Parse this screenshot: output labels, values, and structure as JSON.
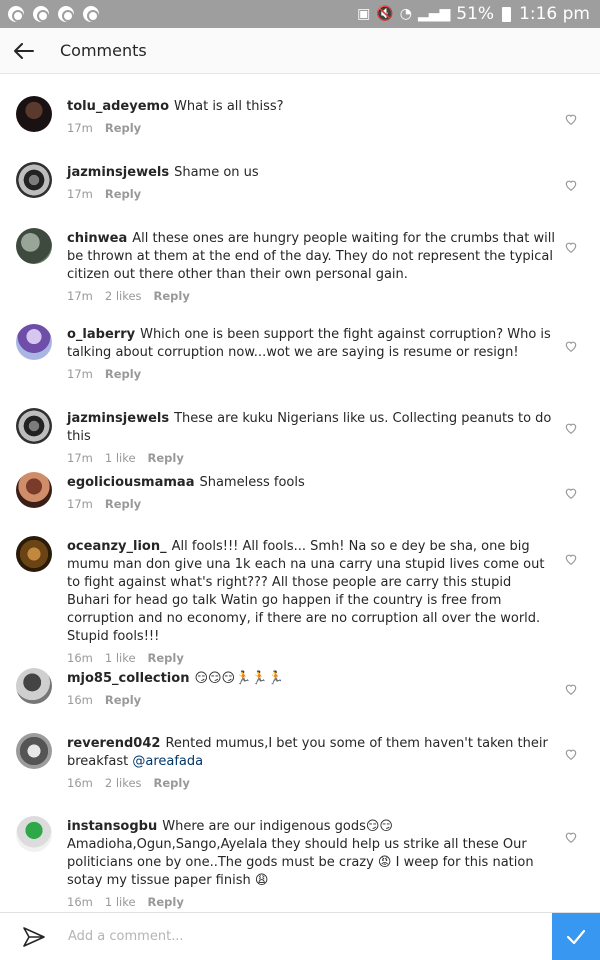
{
  "status_bar": {
    "battery_percent": "51%",
    "time": "1:16 pm",
    "signal_glyph": "↗"
  },
  "header": {
    "title": "Comments",
    "back_icon": "arrow-left-icon"
  },
  "comments": [
    {
      "username": "tolu_adeyemo",
      "text": "What is all thiss?",
      "time": "17m",
      "likes": "",
      "reply_label": "Reply"
    },
    {
      "username": "jazminsjewels",
      "text": "Shame on us",
      "time": "17m",
      "likes": "",
      "reply_label": "Reply"
    },
    {
      "username": "chinwea",
      "text": "All these ones are hungry people waiting for the crumbs that will be thrown at them at the end of the day. They do not represent the typical citizen out there other than their own personal gain.",
      "time": "17m",
      "likes": "2 likes",
      "reply_label": "Reply"
    },
    {
      "username": "o_laberry",
      "text": "Which one is been support the fight against corruption? Who is talking about corruption now...wot we are saying is resume or resign!",
      "time": "17m",
      "likes": "",
      "reply_label": "Reply"
    },
    {
      "username": "jazminsjewels",
      "text": "These are kuku Nigerians like us. Collecting peanuts to do this",
      "time": "17m",
      "likes": "1 like",
      "reply_label": "Reply"
    },
    {
      "username": "egoliciousmamaa",
      "text": "Shameless fools",
      "time": "17m",
      "likes": "",
      "reply_label": "Reply"
    },
    {
      "username": "oceanzy_lion_",
      "text": "All fools!!! All fools... Smh! Na so e dey be sha, one big mumu man don give una 1k each na una carry una stupid lives come out to fight against what's right??? All those people are carry this stupid Buhari for head go talk Watin go happen if the country is free from corruption and no economy, if there are no corruption all over the world. Stupid fools!!!",
      "time": "16m",
      "likes": "1 like",
      "reply_label": "Reply"
    },
    {
      "username": "mjo85_collection",
      "text": "😏😏😏🏃🏃🏃",
      "time": "16m",
      "likes": "",
      "reply_label": "Reply"
    },
    {
      "username": "reverend042",
      "text": "Rented mumus,I bet you some of them haven't taken their breakfast",
      "mention": "@areafada",
      "time": "16m",
      "likes": "2 likes",
      "reply_label": "Reply"
    },
    {
      "username": "instansogbu",
      "text": "Where are our indigenous gods😏😏 Amadioha,Ogun,Sango,Ayelala they should help us strike all these Our politicians one by one..The gods must be crazy 😡 I weep for this nation sotay my tissue paper finish 😩",
      "time": "16m",
      "likes": "1 like",
      "reply_label": "Reply"
    }
  ],
  "composer": {
    "placeholder": "Add a comment...",
    "post_icon": "checkmark-icon"
  },
  "colors": {
    "status_bar": "#9e9e9e",
    "post_button": "#3897f0",
    "meta_text": "#999999",
    "mention": "#003569"
  }
}
